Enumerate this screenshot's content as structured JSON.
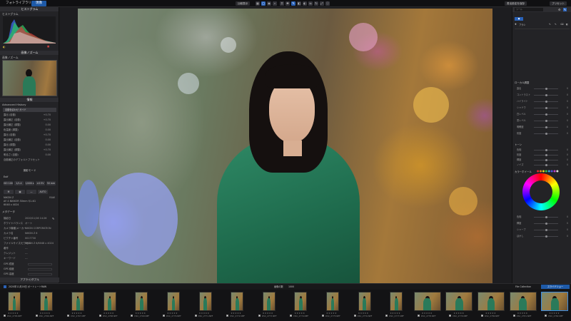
{
  "topbar": {
    "tab_library": "フォトライブラリ",
    "tab_develop": "現像",
    "btn_compare": "比較表示",
    "btn_export": "書出設定を保存",
    "btn_output": "プリセット",
    "icons": [
      "grid-icon",
      "compare-icon",
      "eye-icon",
      "zoom-icon",
      "crop-icon",
      "heal-icon",
      "brush-icon",
      "gradient-icon",
      "mask-icon",
      "flip-icon",
      "rotate-icon",
      "fullscreen-icon"
    ]
  },
  "left": {
    "histogram_title": "ヒストグラム",
    "histogram_sub": "ヒストグラム",
    "navigator_title": "画像ノズーム",
    "navigator_sub": "画像ノズーム",
    "info_title": "情報",
    "advanced_history": "Advanced History",
    "history_items": [
      {
        "label": "露出 (自動)",
        "v": "+0.70"
      },
      {
        "label": "露出補正 (自動)",
        "v": "+0.70"
      },
      {
        "label": "露出補正 (調整)",
        "v": "0.00"
      },
      {
        "label": "色温度 (調整)",
        "v": "0.00"
      },
      {
        "label": "露出 (自動)",
        "v": "+0.70"
      },
      {
        "label": "露出補正 (自動)",
        "v": "0.00"
      },
      {
        "label": "露出 (調整)",
        "v": "0.00"
      },
      {
        "label": "露出補正 (調整)",
        "v": "+0.70"
      },
      {
        "label": "明るさ (自動)",
        "v": "0.00"
      },
      {
        "label": "自動色合わせ  ガイド",
        "v": ""
      },
      {
        "label": "自動補正のデフォルトプリセット",
        "v": ""
      }
    ],
    "camera_title": "撮影モード",
    "exif_label": "Exif",
    "exif_values": [
      "ISO 100",
      "1/1.4",
      "1/400 s",
      "±0 EV",
      "50 mm"
    ],
    "exif_mode": "M",
    "camera_model": "NIKON Z",
    "camera_model_val": "RAW",
    "lens": "AF-S NIKKOR 50mm f/1.4G",
    "size": "6048 x 4024",
    "meta_title": "メタデータ",
    "meta_rows": [
      {
        "label": "撮影日",
        "v": "2020/11/16 14:26"
      },
      {
        "label": "ホワイトバランス",
        "v": "オート"
      },
      {
        "label": "カメラ機種/メーカー",
        "v": "NIKON CORPORATION"
      },
      {
        "label": "カメラ名",
        "v": "NIKON Z 6"
      },
      {
        "label": "ピクチャ番号",
        "v": "0017730"
      },
      {
        "label": "ファイルサイズ/ピクセル",
        "v": "NIKON Z 6/6048 x 4024"
      },
      {
        "label": "著作",
        "v": "---"
      },
      {
        "label": "クレジット",
        "v": "---"
      },
      {
        "label": "キーワード",
        "v": "---"
      }
    ],
    "gps_rows": [
      "GPS 緯度",
      "GPS 経度",
      "GPS 高度"
    ],
    "apply_button": "アプライ/ダブル"
  },
  "right": {
    "panel_title": "ツール",
    "preset_title": "ブラシ",
    "section_color": "カラーホイール",
    "section_local": "ローカル調整",
    "section_tone": "トーン",
    "sliders": [
      {
        "label": "露出",
        "v": "0"
      },
      {
        "label": "コントラスト",
        "v": "0"
      },
      {
        "label": "ハイライト",
        "v": "0"
      },
      {
        "label": "シャドウ",
        "v": "0"
      },
      {
        "label": "白レベル",
        "v": "0"
      },
      {
        "label": "黒レベル",
        "v": "0"
      },
      {
        "label": "明瞭度",
        "v": "0"
      },
      {
        "label": "彩度",
        "v": "0"
      }
    ],
    "sliders2": [
      {
        "label": "色相",
        "v": "0"
      },
      {
        "label": "彩度",
        "v": "0"
      },
      {
        "label": "輝度",
        "v": "0"
      },
      {
        "label": "ノイズ",
        "v": "0"
      }
    ],
    "bottom_rows": [
      {
        "label": "色相",
        "v": "0"
      },
      {
        "label": "輝度",
        "v": "0"
      },
      {
        "label": "シャープ",
        "v": "0"
      },
      {
        "label": "ぼかし",
        "v": "0"
      }
    ]
  },
  "filmbar": {
    "folder": "2020年11月16日 ポートレートRAW",
    "count_label": "画像の数",
    "count": "1000",
    "collection": "File Collection",
    "slideshow": "スライドショー"
  },
  "thumbs": [
    {
      "name": "DSC_2765.NEF"
    },
    {
      "name": "DSC_2766.NEF"
    },
    {
      "name": "DSC_2767.NEF"
    },
    {
      "name": "DSC_2768.NEF"
    },
    {
      "name": "DSC_2769.NEF"
    },
    {
      "name": "DSC_2770.NEF"
    },
    {
      "name": "DSC_2771.NEF"
    },
    {
      "name": "DSC_2772.NEF"
    },
    {
      "name": "DSC_2773.NEF"
    },
    {
      "name": "DSC_2774.NEF"
    },
    {
      "name": "DSC_2775.NEF"
    },
    {
      "name": "DSC_2776.NEF"
    },
    {
      "name": "DSC_2777.NEF"
    },
    {
      "name": "DSC_2778.NEF"
    },
    {
      "name": "DSC_2779.NEF"
    },
    {
      "name": "DSC_2780.NEF"
    },
    {
      "name": "DSC_2781.NEF"
    },
    {
      "name": "DSC_2782.NEF"
    }
  ],
  "colors": {
    "accent": "#1e5aa8",
    "panel": "#232326"
  }
}
